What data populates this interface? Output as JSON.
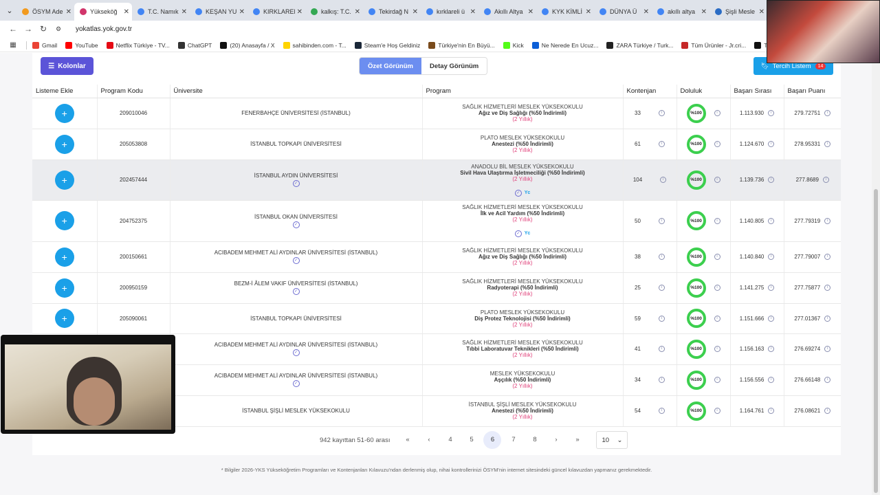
{
  "browser": {
    "tabs": [
      {
        "title": "ÖSYM Ade",
        "icon": "osym-favicon",
        "color": "#f29a1e",
        "active": false
      },
      {
        "title": "Yükseköğ",
        "icon": "yok-favicon",
        "color": "#d1356b",
        "active": true
      },
      {
        "title": "T.C. Namık",
        "icon": "google-favicon",
        "color": "#4285f4",
        "active": false
      },
      {
        "title": "KEŞAN YU",
        "icon": "google-favicon",
        "color": "#4285f4",
        "active": false
      },
      {
        "title": "KIRKLAREL",
        "icon": "google-favicon",
        "color": "#4285f4",
        "active": false
      },
      {
        "title": "kalkış: T.C.",
        "icon": "maps-favicon",
        "color": "#34a853",
        "active": false
      },
      {
        "title": "Tekirdağ N",
        "icon": "google-favicon",
        "color": "#4285f4",
        "active": false
      },
      {
        "title": "kırklareli ü",
        "icon": "google-favicon",
        "color": "#4285f4",
        "active": false
      },
      {
        "title": "Akıllı Altya",
        "icon": "google-favicon",
        "color": "#4285f4",
        "active": false
      },
      {
        "title": "KYK KİMLİ",
        "icon": "google-favicon",
        "color": "#4285f4",
        "active": false
      },
      {
        "title": "DÜNYA Ü",
        "icon": "google-favicon",
        "color": "#4285f4",
        "active": false
      },
      {
        "title": "akıllı altya",
        "icon": "google-favicon",
        "color": "#4285f4",
        "active": false
      },
      {
        "title": "Şişli Mesle",
        "icon": "sisli-favicon",
        "color": "#2b6cc4",
        "active": false
      }
    ],
    "url": "yokatlas.yok.gov.tr",
    "bookmarks": [
      {
        "label": "Gmail",
        "color": "#ea4335"
      },
      {
        "label": "YouTube",
        "color": "#ff0000"
      },
      {
        "label": "Netflix Türkiye - TV...",
        "color": "#e50914"
      },
      {
        "label": "ChatGPT",
        "color": "#333333"
      },
      {
        "label": "(20) Anasayfa / X",
        "color": "#111111"
      },
      {
        "label": "sahibinden.com - T...",
        "color": "#ffd400"
      },
      {
        "label": "Steam'e Hoş Geldiniz",
        "color": "#1b2838"
      },
      {
        "label": "Türkiye'nin En Büyü...",
        "color": "#7a4b1c"
      },
      {
        "label": "Kick",
        "color": "#53fc18"
      },
      {
        "label": "Ne Nerede En Ucuz...",
        "color": "#0b5ed7"
      },
      {
        "label": "ZARA Türkiye / Turk...",
        "color": "#222222"
      },
      {
        "label": "Tüm Ürünler - Jr.cri...",
        "color": "#c62828"
      },
      {
        "label": "TikTok - Make You",
        "color": "#111111"
      }
    ]
  },
  "toolbar": {
    "columns_label": "Kolonlar",
    "summary_view_label": "Özet Görünüm",
    "detail_view_label": "Detay Görünüm",
    "tercih_label": "Tercih Listem",
    "tercih_count": "14"
  },
  "table": {
    "headers": [
      "Listeme Ekle",
      "Program Kodu",
      "Üniversite",
      "Program",
      "Kontenjan",
      "Doluluk",
      "Başarı Sırası",
      "Başarı Puanı"
    ],
    "rows": [
      {
        "code": "209010046",
        "university": "FENERBAHÇE ÜNİVERSİTESİ (İSTANBUL)",
        "verified": false,
        "faculty": "SAĞLIK HİZMETLERİ MESLEK YÜKSEKOKULU",
        "program": "Ağız ve Diş Sağlığı (%50 İndirimli)",
        "duration": "(2 Yıllık)",
        "prog_badges": false,
        "quota": "33",
        "fill": "%100",
        "rank": "1.113.930",
        "score": "279.72751"
      },
      {
        "code": "205053808",
        "university": "İSTANBUL TOPKAPI ÜNİVERSİTESİ",
        "verified": false,
        "faculty": "PLATO MESLEK YÜKSEKOKULU",
        "program": "Anestezi (%50 İndirimli)",
        "duration": "(2 Yıllık)",
        "prog_badges": false,
        "quota": "61",
        "fill": "%100",
        "rank": "1.124.670",
        "score": "278.95331"
      },
      {
        "code": "202457444",
        "university": "İSTANBUL AYDIN ÜNİVERSİTESİ",
        "verified": true,
        "faculty": "ANADOLU BİL MESLEK YÜKSEKOKULU",
        "program": "Sivil Hava Ulaştırma İşletmeciliği (%50 İndirimli)",
        "duration": "(2 Yıllık)",
        "prog_badges": true,
        "quota": "104",
        "fill": "%100",
        "rank": "1.139.736",
        "score": "277.8689"
      },
      {
        "code": "204752375",
        "university": "İSTANBUL OKAN ÜNİVERSİTESİ",
        "verified": true,
        "faculty": "SAĞLIK HİZMETLERİ MESLEK YÜKSEKOKULU",
        "program": "İlk ve Acil Yardım (%50 İndirimli)",
        "duration": "(2 Yıllık)",
        "prog_badges": true,
        "quota": "50",
        "fill": "%100",
        "rank": "1.140.805",
        "score": "277.79319"
      },
      {
        "code": "200150661",
        "university": "ACIBADEM MEHMET ALİ AYDINLAR ÜNİVERSİTESİ (İSTANBUL)",
        "verified": true,
        "faculty": "SAĞLIK HİZMETLERİ MESLEK YÜKSEKOKULU",
        "program": "Ağız ve Diş Sağlığı (%50 İndirimli)",
        "duration": "(2 Yıllık)",
        "prog_badges": false,
        "quota": "38",
        "fill": "%100",
        "rank": "1.140.840",
        "score": "277.79007"
      },
      {
        "code": "200950159",
        "university": "BEZM-İ ÂLEM VAKIF ÜNİVERSİTESİ (İSTANBUL)",
        "verified": true,
        "faculty": "SAĞLIK HİZMETLERİ MESLEK YÜKSEKOKULU",
        "program": "Radyoterapi (%50 İndirimli)",
        "duration": "(2 Yıllık)",
        "prog_badges": false,
        "quota": "25",
        "fill": "%100",
        "rank": "1.141.275",
        "score": "277.75877"
      },
      {
        "code": "205090061",
        "university": "İSTANBUL TOPKAPI ÜNİVERSİTESİ",
        "verified": false,
        "faculty": "PLATO MESLEK YÜKSEKOKULU",
        "program": "Diş Protez Teknolojisi (%50 İndirimli)",
        "duration": "(2 Yıllık)",
        "prog_badges": false,
        "quota": "59",
        "fill": "%100",
        "rank": "1.151.666",
        "score": "277.01367"
      },
      {
        "code": "",
        "university": "ACIBADEM MEHMET ALİ AYDINLAR ÜNİVERSİTESİ (İSTANBUL)",
        "verified": true,
        "faculty": "SAĞLIK HİZMETLERİ MESLEK YÜKSEKOKULU",
        "program": "Tıbbi Laboratuvar Teknikleri (%50 İndirimli)",
        "duration": "(2 Yıllık)",
        "prog_badges": false,
        "quota": "41",
        "fill": "%100",
        "rank": "1.156.163",
        "score": "276.69274"
      },
      {
        "code": "",
        "university": "ACIBADEM MEHMET ALİ AYDINLAR ÜNİVERSİTESİ (İSTANBUL)",
        "verified": true,
        "faculty": "MESLEK YÜKSEKOKULU",
        "program": "Aşçılık (%50 İndirimli)",
        "duration": "(2 Yıllık)",
        "prog_badges": false,
        "quota": "34",
        "fill": "%100",
        "rank": "1.156.556",
        "score": "276.66148"
      },
      {
        "code": "",
        "university": "İSTANBUL ŞİŞLİ MESLEK YÜKSEKOKULU",
        "verified": false,
        "faculty": "İSTANBUL ŞİŞLİ MESLEK YÜKSEKOKULU",
        "program": "Anestezi (%50 İndirimli)",
        "duration": "(2 Yıllık)",
        "prog_badges": false,
        "quota": "54",
        "fill": "%100",
        "rank": "1.164.761",
        "score": "276.08621"
      }
    ]
  },
  "pagination": {
    "summary": "942 kayıttan 51-60 arası",
    "first": "«",
    "prev": "‹",
    "pages": [
      "4",
      "5",
      "6",
      "7",
      "8"
    ],
    "current": "6",
    "next": "›",
    "last": "»",
    "page_size": "10"
  },
  "footer": {
    "note": "* Bilgiler 2026-YKS Yükseköğretim Programları ve Kontenjanları Kılavuzu'ndan derlenmiş olup, nihai kontrollerinizi ÖSYM'nin internet sitesindeki güncel kılavuzdan yapmanız gerekmektedir."
  },
  "colors": {
    "primary": "#5b54d8",
    "accent": "#1aa0e8",
    "fill_ring": "#3ccf4e",
    "duration": "#e0407a"
  }
}
